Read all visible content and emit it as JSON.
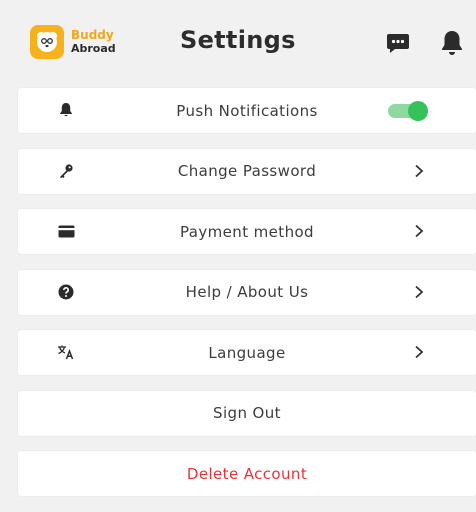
{
  "app": {
    "logo_line1": "Buddy",
    "logo_line2": "Abroad",
    "title": "Settings"
  },
  "header_icons": [
    "chat-icon",
    "bell-icon"
  ],
  "settings": {
    "push_notifications": {
      "label": "Push Notifications",
      "icon": "bell-icon",
      "enabled": true
    },
    "change_password": {
      "label": "Change Password",
      "icon": "key-icon"
    },
    "payment_method": {
      "label": "Payment method",
      "icon": "credit-card-icon"
    },
    "help_about": {
      "label": "Help / About Us",
      "icon": "help-circle-icon"
    },
    "language": {
      "label": "Language",
      "icon": "translate-icon"
    },
    "sign_out": {
      "label": "Sign Out"
    },
    "delete_account": {
      "label": "Delete Account"
    }
  },
  "colors": {
    "background": "#f1f1f1",
    "brand_yellow": "#f6b21c",
    "toggle_on": "#35c25a",
    "danger": "#e8323c"
  }
}
